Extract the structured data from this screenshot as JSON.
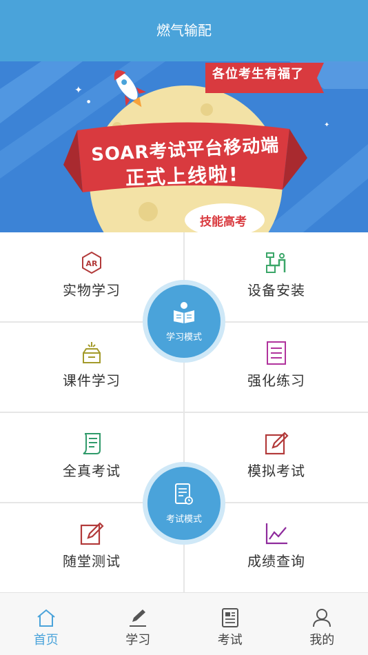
{
  "titlebar": {
    "title": "燃气输配"
  },
  "banner": {
    "ribbon": "各位考生有福了",
    "headline_line1": "SOAR考试平台移动端",
    "headline_line2": "正式上线啦!",
    "stamp": "技能高考"
  },
  "study": {
    "items": [
      {
        "label": "实物学习",
        "icon": "ar-icon"
      },
      {
        "label": "设备安装",
        "icon": "pipe-icon"
      },
      {
        "label": "课件学习",
        "icon": "box-icon"
      },
      {
        "label": "强化练习",
        "icon": "list-icon"
      }
    ],
    "center_label": "学习模式"
  },
  "exam": {
    "items": [
      {
        "label": "全真考试",
        "icon": "scroll-icon"
      },
      {
        "label": "模拟考试",
        "icon": "edit-icon"
      },
      {
        "label": "随堂测试",
        "icon": "edit-icon"
      },
      {
        "label": "成绩查询",
        "icon": "chart-icon"
      }
    ],
    "center_label": "考试模式"
  },
  "tabs": [
    {
      "label": "首页",
      "icon": "home-icon"
    },
    {
      "label": "学习",
      "icon": "pen-icon"
    },
    {
      "label": "考试",
      "icon": "newspaper-icon"
    },
    {
      "label": "我的",
      "icon": "user-icon"
    }
  ],
  "colors": {
    "accent": "#4aa3da",
    "ribbon": "#d93a3f",
    "moon": "#f3e2a6"
  }
}
